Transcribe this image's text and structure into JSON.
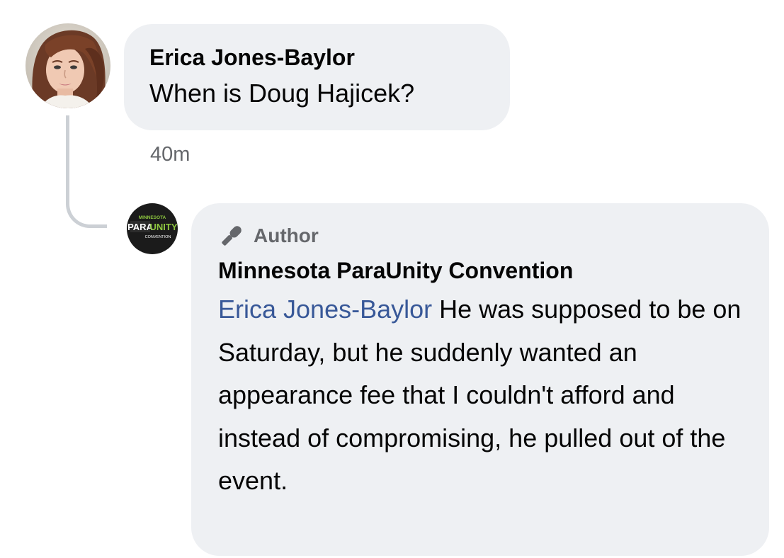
{
  "comment": {
    "author": "Erica Jones-Baylor",
    "text": "When is Doug Hajicek?",
    "timestamp": "40m"
  },
  "reply": {
    "badge_label": "Author",
    "author": "Minnesota ParaUnity Convention",
    "mention": "Erica Jones-Baylor",
    "text": "He was supposed to be on Saturday, but he suddenly wanted an appearance fee that I couldn't afford and instead of compromising, he pulled out of the event.",
    "logo_text": {
      "top": "MINNESOTA",
      "para": "PARA",
      "unity": "UNITY",
      "bottom": "CONVENTION"
    }
  },
  "icons": {
    "badge_icon": "microphone-icon"
  },
  "colors": {
    "bubble_bg": "#eef0f3",
    "mention": "#385898",
    "secondary_text": "#65676b",
    "thread_line": "#ccd0d5",
    "logo_green": "#8dc63f"
  }
}
